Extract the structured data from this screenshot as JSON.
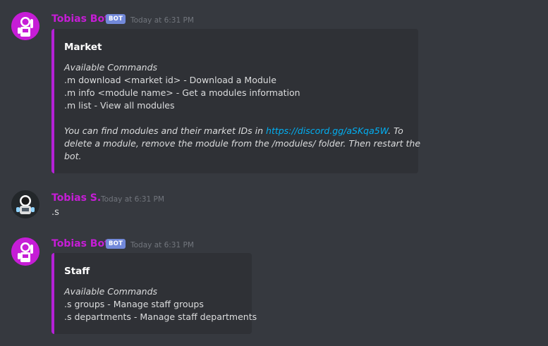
{
  "colors": {
    "background": "#36393f",
    "embed_background": "#2f3136",
    "embed_accent": "#b521d6",
    "username_bot": "#c61dd6",
    "username_user": "#c61dd6",
    "bot_tag": "#7289da",
    "link": "#00b0f4"
  },
  "messages": [
    {
      "username": "Tobias Bot",
      "bot_tag": "BOT",
      "timestamp": "Today at 6:31 PM",
      "avatar_icon": "robot-avatar-icon",
      "embed": {
        "title": "Market",
        "lines": [
          "Available Commands",
          ".m download <market id> - Download a Module",
          ".m info <module name> - Get a modules information",
          ".m list - View all modules"
        ],
        "footer_pre": "You can find modules and their market IDs in ",
        "footer_link": "https://discord.gg/aSKqa5W",
        "footer_post": ". To",
        "footer_line2": "delete a module, remove the module from the /modules/ folder. Then restart the",
        "footer_line3": "bot."
      }
    },
    {
      "username": "Tobias S.",
      "timestamp": "Today at 6:31 PM",
      "avatar_icon": "astronaut-avatar-icon",
      "content": ".s"
    },
    {
      "username": "Tobias Bot",
      "bot_tag": "BOT",
      "timestamp": "Today at 6:31 PM",
      "avatar_icon": "robot-avatar-icon",
      "embed": {
        "title": "Staff",
        "lines": [
          "Available Commands",
          ".s groups - Manage staff groups",
          ".s departments - Manage staff departments"
        ]
      }
    }
  ]
}
